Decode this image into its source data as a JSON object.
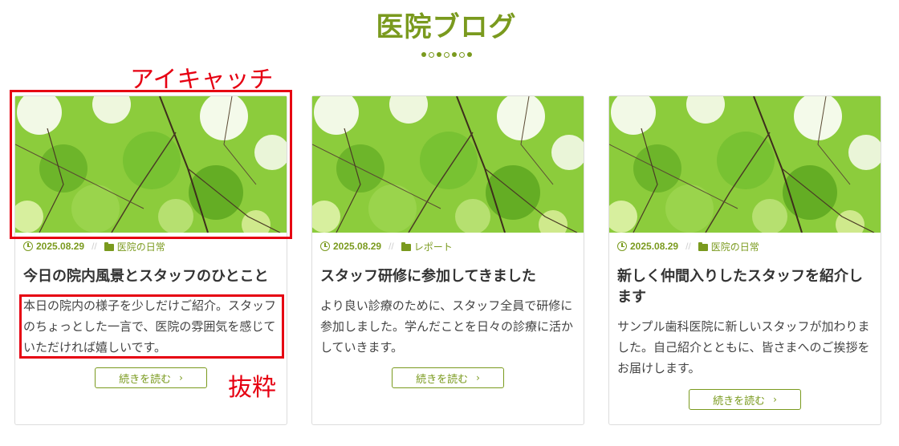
{
  "section": {
    "title": "医院ブログ"
  },
  "colors": {
    "accent": "#7a9a1e",
    "annotation": "#e60012",
    "border": "#dcdcdc"
  },
  "posts": [
    {
      "date": "2025.08.29",
      "category": "医院の日常",
      "title": "今日の院内風景とスタッフのひとこと",
      "excerpt": "本日の院内の様子を少しだけご紹介。スタッフのちょっとした一言で、医院の雰囲気を感じていただければ嬉しいです。",
      "read_more": "続きを読む"
    },
    {
      "date": "2025.08.29",
      "category": "レポート",
      "title": "スタッフ研修に参加してきました",
      "excerpt": "より良い診療のために、スタッフ全員で研修に参加しました。学んだことを日々の診療に活かしていきます。",
      "read_more": "続きを読む"
    },
    {
      "date": "2025.08.29",
      "category": "医院の日常",
      "title": "新しく仲間入りしたスタッフを紹介します",
      "excerpt": "サンプル歯科医院に新しいスタッフが加わりました。自己紹介とともに、皆さまへのご挨拶をお届けします。",
      "read_more": "続きを読む"
    }
  ],
  "annotations": {
    "eyecatch_label": "アイキャッチ",
    "excerpt_label": "抜粋"
  },
  "icons": {
    "date": "clock-icon",
    "category": "folder-icon",
    "read_more": "chevron-right-icon"
  }
}
